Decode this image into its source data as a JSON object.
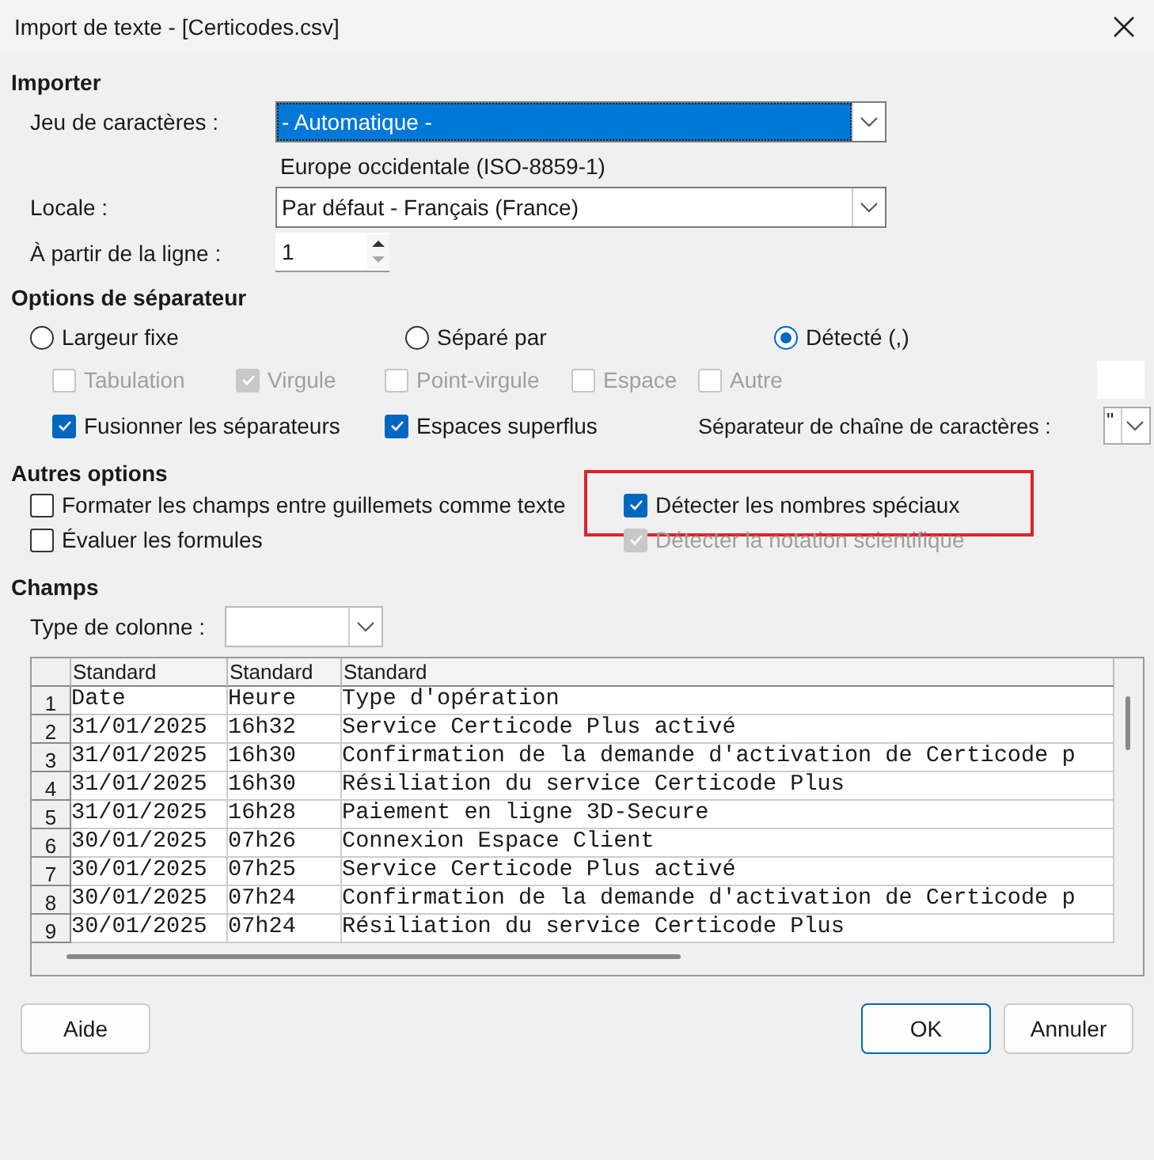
{
  "window": {
    "title": "Import de texte - [Certicodes.csv]"
  },
  "import": {
    "heading": "Importer",
    "charset": {
      "label": "Jeu de caractères :",
      "value": "- Automatique -",
      "focused": true
    },
    "charset_note": "Europe occidentale (ISO-8859-1)",
    "locale": {
      "label": "Locale :",
      "value": "Par défaut - Français (France)",
      "focused": false
    },
    "from_row": {
      "label": "À partir de la ligne :",
      "value": "1"
    }
  },
  "separator_options": {
    "heading": "Options de séparateur",
    "modes": [
      {
        "label": "Largeur fixe",
        "selected": false
      },
      {
        "label": "Séparé par",
        "selected": false
      },
      {
        "label": "Détecté (,)",
        "selected": true
      }
    ],
    "separators": [
      {
        "label": "Tabulation",
        "checked": false,
        "disabled": true
      },
      {
        "label": "Virgule",
        "checked": true,
        "disabled": true
      },
      {
        "label": "Point-virgule",
        "checked": false,
        "disabled": true
      },
      {
        "label": "Espace",
        "checked": false,
        "disabled": true
      },
      {
        "label": "Autre",
        "checked": false,
        "disabled": true
      }
    ],
    "flags": [
      {
        "label": "Fusionner les séparateurs",
        "checked": true,
        "disabled": false
      },
      {
        "label": "Espaces superflus",
        "checked": true,
        "disabled": false
      }
    ],
    "string_delimiter": {
      "label": "Séparateur de chaîne de caractères :",
      "value": "\""
    }
  },
  "other_options": {
    "heading": "Autres options",
    "options": [
      {
        "label": "Formater les champs entre guillemets comme texte",
        "checked": false,
        "disabled": false,
        "highlighted": false
      },
      {
        "label": "Détecter les nombres spéciaux",
        "checked": true,
        "disabled": false,
        "highlighted": true
      },
      {
        "label": "Évaluer les formules",
        "checked": false,
        "disabled": false,
        "highlighted": false
      },
      {
        "label": "Détecter la notation scientifique",
        "checked": true,
        "disabled": true,
        "highlighted": false
      }
    ]
  },
  "fields": {
    "heading": "Champs",
    "column_type": {
      "label": "Type de colonne :"
    },
    "table": {
      "columns": [
        "Standard",
        "Standard",
        "Standard"
      ],
      "rows": [
        {
          "number": "1",
          "cells": [
            "Date",
            "Heure",
            "Type d'opération"
          ]
        },
        {
          "number": "2",
          "cells": [
            "31/01/2025",
            "16h32",
            "Service Certicode Plus activé"
          ]
        },
        {
          "number": "3",
          "cells": [
            "31/01/2025",
            "16h30",
            "Confirmation de la demande d'activation de Certicode p"
          ]
        },
        {
          "number": "4",
          "cells": [
            "31/01/2025",
            "16h30",
            "Résiliation du service Certicode Plus"
          ]
        },
        {
          "number": "5",
          "cells": [
            "31/01/2025",
            "16h28",
            "Paiement en ligne 3D-Secure"
          ]
        },
        {
          "number": "6",
          "cells": [
            "30/01/2025",
            "07h26",
            "Connexion Espace Client"
          ]
        },
        {
          "number": "7",
          "cells": [
            "30/01/2025",
            "07h25",
            "Service Certicode Plus activé"
          ]
        },
        {
          "number": "8",
          "cells": [
            "30/01/2025",
            "07h24",
            "Confirmation de la demande d'activation de Certicode p"
          ]
        },
        {
          "number": "9",
          "cells": [
            "30/01/2025",
            "07h24",
            "Résiliation du service Certicode Plus"
          ]
        }
      ]
    }
  },
  "buttons": {
    "left": [
      {
        "label": "Aide",
        "default": false
      }
    ],
    "right": [
      {
        "label": "OK",
        "default": true
      },
      {
        "label": "Annuler",
        "default": false
      }
    ]
  }
}
